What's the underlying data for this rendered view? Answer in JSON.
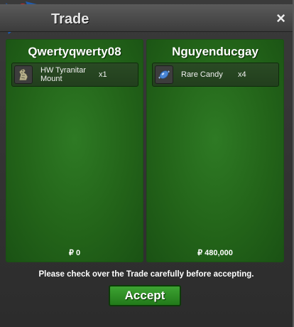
{
  "window": {
    "title": "Trade",
    "close_label": "×"
  },
  "left": {
    "player": "Qwertyqwerty08",
    "item": {
      "name": "HW Tyranitar Mount",
      "qty": "x1",
      "icon": "tyranitar-mount-icon"
    },
    "money": "₽ 0"
  },
  "right": {
    "player": "Nguyenducgay",
    "item": {
      "name": "Rare Candy",
      "qty": "x4",
      "icon": "rare-candy-icon"
    },
    "money": "₽ 480,000"
  },
  "notice": "Please check over the Trade carefully before accepting.",
  "accept_label": "Accept",
  "colors": {
    "panel": "#236419",
    "accent": "#3da332"
  }
}
